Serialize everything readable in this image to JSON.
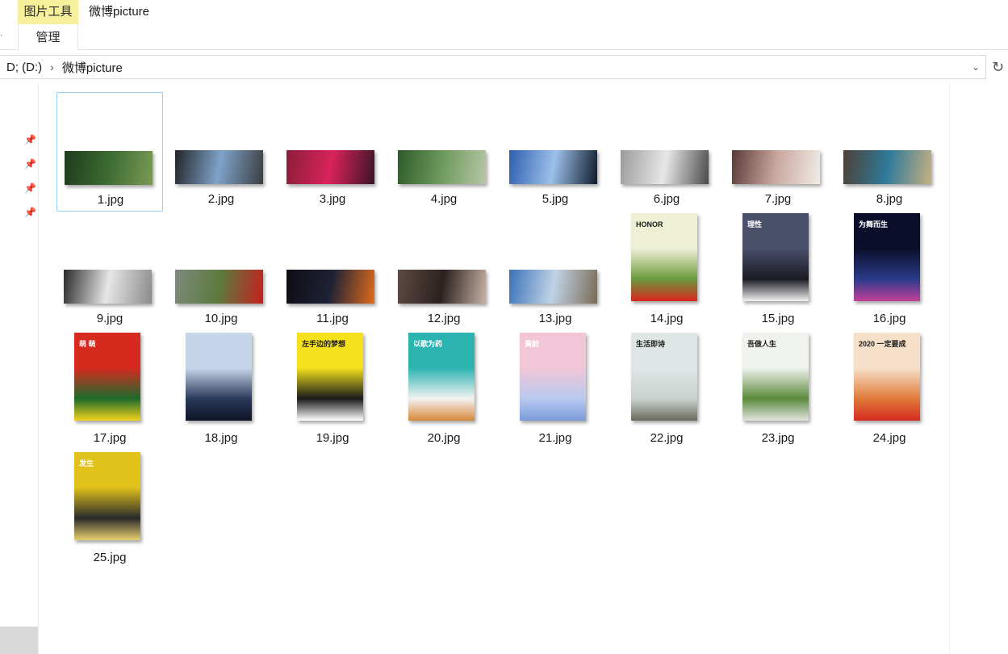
{
  "ribbon": {
    "context_tab": "图片工具",
    "context_group": "管理",
    "window_title": "微博picture"
  },
  "address": {
    "crumbs": [
      "D; (D:)",
      "微博picture"
    ]
  },
  "files": [
    {
      "name": "1.jpg",
      "shape": "land",
      "colors": [
        "#1f3a1c",
        "#3d6b32",
        "#7a9a55"
      ]
    },
    {
      "name": "2.jpg",
      "shape": "land",
      "colors": [
        "#222428",
        "#7fa3c9",
        "#3b3d41"
      ]
    },
    {
      "name": "3.jpg",
      "shape": "land",
      "colors": [
        "#8b1d3a",
        "#d9235b",
        "#3a1426"
      ]
    },
    {
      "name": "4.jpg",
      "shape": "land",
      "colors": [
        "#2e5a2a",
        "#6e9a5c",
        "#b7c7a8"
      ]
    },
    {
      "name": "5.jpg",
      "shape": "land",
      "colors": [
        "#2d5fb0",
        "#9cc0ea",
        "#0e1a2a"
      ]
    },
    {
      "name": "6.jpg",
      "shape": "land",
      "colors": [
        "#9a9a9a",
        "#e8e8e8",
        "#4a4a4a"
      ]
    },
    {
      "name": "7.jpg",
      "shape": "land",
      "colors": [
        "#5a3a36",
        "#c9a89e",
        "#f1ece6"
      ]
    },
    {
      "name": "8.jpg",
      "shape": "land",
      "colors": [
        "#4e4034",
        "#2f7a9b",
        "#c5b080"
      ]
    },
    {
      "name": "9.jpg",
      "shape": "land",
      "colors": [
        "#2a2a2a",
        "#e6e6e6",
        "#8a8a8a"
      ]
    },
    {
      "name": "10.jpg",
      "shape": "land",
      "colors": [
        "#7d8a7c",
        "#5c7b3e",
        "#c51f1f"
      ]
    },
    {
      "name": "11.jpg",
      "shape": "land",
      "colors": [
        "#0d0d14",
        "#1e2235",
        "#e06b1d"
      ]
    },
    {
      "name": "12.jpg",
      "shape": "land",
      "colors": [
        "#5e4a42",
        "#2a2220",
        "#c9b2a4"
      ]
    },
    {
      "name": "13.jpg",
      "shape": "land",
      "colors": [
        "#3a72b9",
        "#c0d3e6",
        "#7a6a55"
      ]
    },
    {
      "name": "14.jpg",
      "shape": "port",
      "colors": [
        "#eef0d6",
        "#6a9a3c",
        "#d9261c"
      ]
    },
    {
      "name": "15.jpg",
      "shape": "port",
      "colors": [
        "#4a4f6a",
        "#1a1a24",
        "#f2f2f2"
      ]
    },
    {
      "name": "16.jpg",
      "shape": "port",
      "colors": [
        "#0a0e2a",
        "#2a3b8a",
        "#c2409a"
      ]
    },
    {
      "name": "17.jpg",
      "shape": "port",
      "colors": [
        "#d62a1f",
        "#1d6b2c",
        "#f2d21a"
      ]
    },
    {
      "name": "18.jpg",
      "shape": "port",
      "colors": [
        "#c6d6ea",
        "#2a3a5a",
        "#0f1426"
      ]
    },
    {
      "name": "19.jpg",
      "shape": "port",
      "colors": [
        "#f5e21c",
        "#1a1a1a",
        "#ffffff"
      ]
    },
    {
      "name": "20.jpg",
      "shape": "port",
      "colors": [
        "#2bb3b0",
        "#f2f2f2",
        "#d9893a"
      ]
    },
    {
      "name": "21.jpg",
      "shape": "port",
      "colors": [
        "#f2c6d6",
        "#b9c9f0",
        "#7a9ad8"
      ]
    },
    {
      "name": "22.jpg",
      "shape": "port",
      "colors": [
        "#dfe6e6",
        "#c9d2cf",
        "#6a6a5c"
      ]
    },
    {
      "name": "23.jpg",
      "shape": "port",
      "colors": [
        "#f0f2ee",
        "#5a8a3c",
        "#e2e5e0"
      ]
    },
    {
      "name": "24.jpg",
      "shape": "port",
      "colors": [
        "#f6e0c9",
        "#e07a3a",
        "#d62a1f"
      ]
    },
    {
      "name": "25.jpg",
      "shape": "port",
      "colors": [
        "#e0c21a",
        "#2a2a2a",
        "#e8d070"
      ]
    }
  ],
  "poster_texts": {
    "14.jpg": "HONOR",
    "15.jpg": "理性",
    "16.jpg": "为舞而生",
    "17.jpg": "萌 萌",
    "19.jpg": "左手边的梦想",
    "20.jpg": "以歌为药",
    "21.jpg": "黄龄",
    "22.jpg": "生活即诗",
    "23.jpg": "吾做人生",
    "24.jpg": "2020 一定要成",
    "25.jpg": "发生"
  },
  "icons": {
    "pin": "pin-icon",
    "chevron_right": "chevron-right-icon",
    "chevron_down": "chevron-down-icon",
    "refresh": "refresh-icon"
  }
}
